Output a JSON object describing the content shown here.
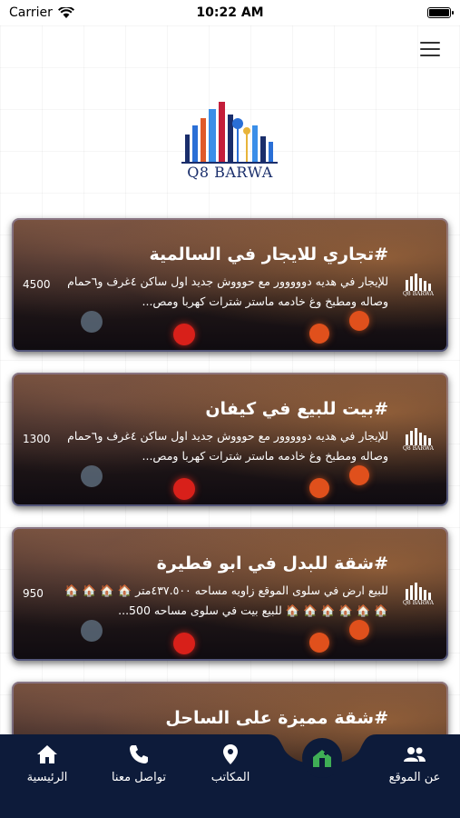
{
  "status_bar": {
    "carrier": "Carrier",
    "time": "10:22 AM"
  },
  "brand": {
    "logo_text": "Q8 BARWA",
    "card_logo_text": "Q8 BARWA"
  },
  "listings": [
    {
      "title": "#تجاري للايجار في السالمية",
      "description": "للإيجار في هديه دووووور مع حوووش جديد اول ساكن ٤غرف و٦حمام وصاله ومطبخ وغ خادمه ماستر شترات كهربا ومص...",
      "price": "4500"
    },
    {
      "title": "#بيت للبيع في كيفان",
      "description": "للإيجار في هديه دووووور مع حوووش جديد اول ساكن ٤غرف و٦حمام وصاله ومطبخ وغ خادمه ماستر شترات كهربا ومص...",
      "price": "1300"
    },
    {
      "title": "#شقة للبدل في ابو فطيرة",
      "description": "للبيع ارض في سلوى الموقع زاويه مساحه ٤٣٧.٥٠٠متر 🏠 🏠 🏠 🏠 🏠 🏠 🏠 🏠 🏠 🏠 للبيع بيت في سلوى مساحه 500...",
      "price": "950"
    },
    {
      "title": "#شقة مميزة على الساحل",
      "description": "",
      "price": ""
    }
  ],
  "bottom_nav": {
    "about": "عن الموقع",
    "offices": "المكاتب",
    "contact": "تواصل معنا",
    "home": "الرئيسية"
  },
  "colors": {
    "nav_bg": "#0d1b3a",
    "center_icon": "#3fae55",
    "logo_blue": "#1a2e6b"
  },
  "icons": [
    "wifi-icon",
    "battery-icon",
    "menu-icon",
    "people-icon",
    "add-home-icon",
    "location-pin-icon",
    "phone-icon",
    "home-icon"
  ]
}
